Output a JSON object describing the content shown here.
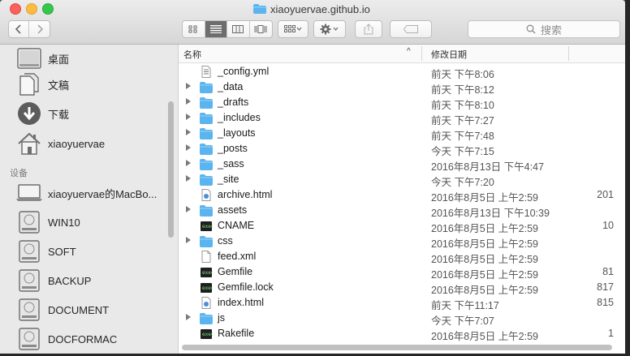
{
  "window": {
    "title": "xiaoyuervae.github.io"
  },
  "toolbar": {
    "back_label": "<",
    "forward_label": ">",
    "search_placeholder": "搜索"
  },
  "sidebar": {
    "favorites": [
      {
        "label": "桌面",
        "icon": "desktop-icon"
      },
      {
        "label": "文稿",
        "icon": "documents-icon"
      },
      {
        "label": "下载",
        "icon": "downloads-icon"
      },
      {
        "label": "xiaoyuervae",
        "icon": "home-icon"
      }
    ],
    "devices_header": "设备",
    "devices": [
      {
        "label": "xiaoyuervae的MacBo...",
        "icon": "laptop-icon"
      },
      {
        "label": "WIN10",
        "icon": "disk-icon"
      },
      {
        "label": "SOFT",
        "icon": "disk-icon"
      },
      {
        "label": "BACKUP",
        "icon": "disk-icon"
      },
      {
        "label": "DOCUMENT",
        "icon": "disk-icon"
      },
      {
        "label": "DOCFORMAC",
        "icon": "disk-icon"
      }
    ]
  },
  "columns": {
    "name": "名称",
    "date": "修改日期",
    "sort_indicator": "^"
  },
  "files": [
    {
      "name": "_config.yml",
      "type": "yaml",
      "date": "前天 下午8:06",
      "size": ""
    },
    {
      "name": "_data",
      "type": "folder",
      "date": "前天 下午8:12",
      "size": ""
    },
    {
      "name": "_drafts",
      "type": "folder",
      "date": "前天 下午8:10",
      "size": ""
    },
    {
      "name": "_includes",
      "type": "folder",
      "date": "前天 下午7:27",
      "size": ""
    },
    {
      "name": "_layouts",
      "type": "folder",
      "date": "前天 下午7:48",
      "size": ""
    },
    {
      "name": "_posts",
      "type": "folder",
      "date": "今天 下午7:15",
      "size": ""
    },
    {
      "name": "_sass",
      "type": "folder",
      "date": "2016年8月13日 下午4:47",
      "size": ""
    },
    {
      "name": "_site",
      "type": "folder",
      "date": "今天 下午7:20",
      "size": ""
    },
    {
      "name": "archive.html",
      "type": "html",
      "date": "2016年8月5日 上午2:59",
      "size": "201"
    },
    {
      "name": "assets",
      "type": "folder",
      "date": "2016年8月13日 下午10:39",
      "size": ""
    },
    {
      "name": "CNAME",
      "type": "exec",
      "date": "2016年8月5日 上午2:59",
      "size": "10"
    },
    {
      "name": "css",
      "type": "folder",
      "date": "2016年8月5日 上午2:59",
      "size": ""
    },
    {
      "name": "feed.xml",
      "type": "plain",
      "date": "2016年8月5日 上午2:59",
      "size": ""
    },
    {
      "name": "Gemfile",
      "type": "exec",
      "date": "2016年8月5日 上午2:59",
      "size": "81"
    },
    {
      "name": "Gemfile.lock",
      "type": "exec",
      "date": "2016年8月5日 上午2:59",
      "size": "817"
    },
    {
      "name": "index.html",
      "type": "html",
      "date": "前天 下午11:17",
      "size": "815"
    },
    {
      "name": "js",
      "type": "folder",
      "date": "今天 下午7:07",
      "size": ""
    },
    {
      "name": "Rakefile",
      "type": "exec",
      "date": "2016年8月5日 上午2:59",
      "size": "1"
    }
  ],
  "colors": {
    "folder": "#5ab4ef",
    "selected_segment": "#6d6d6d",
    "sidebar_bg": "#e9e9ea"
  }
}
